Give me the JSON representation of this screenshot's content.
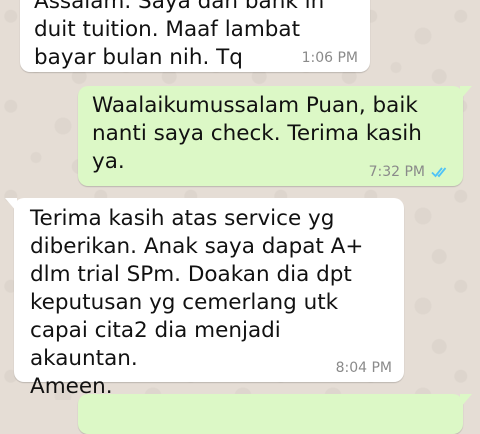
{
  "messages": [
    {
      "direction": "incoming",
      "text": "Assalam. Saya dah bank in\nduit tuition. Maaf lambat\nbayar bulan nih. Tq",
      "time": "1:06 PM"
    },
    {
      "direction": "outgoing",
      "text": "Waalaikumussalam Puan, baik\nnanti saya check. Terima kasih\nya.",
      "time": "7:32 PM",
      "status_icon": "double-check-read-icon",
      "status_color": "#4fc3f7"
    },
    {
      "direction": "incoming",
      "text": "Terima kasih atas service yg\ndiberikan. Anak saya dapat A+\ndlm trial SPm. Doakan dia dpt\nkeputusan yg cemerlang utk\ncapai cita2 dia menjadi akauntan.\nAmeen.",
      "time": "8:04 PM"
    },
    {
      "direction": "outgoing",
      "text": "",
      "time": ""
    }
  ],
  "colors": {
    "chat_background": "#e5ddd5",
    "incoming_bubble": "#ffffff",
    "outgoing_bubble": "#dcf8c6",
    "timestamp": "#8a8a8a"
  }
}
